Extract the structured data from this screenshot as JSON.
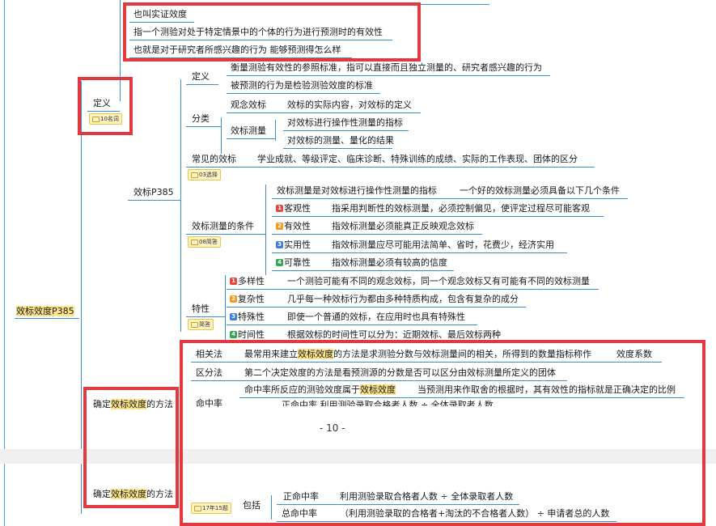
{
  "root": {
    "label": "效标效度P385"
  },
  "intro": [
    "也叫实证效度",
    "指一个测验对处于特定情景中的个体的行为进行预测时的有效性",
    "也就是对于研究者所感兴趣的行为 能够预测得怎么样"
  ],
  "definition": {
    "label": "定义",
    "badge": "10名词"
  },
  "criterion": {
    "label": "效标P385",
    "def_label": "定义",
    "def_items": [
      "衡量测验有效性的参照标准，指可以直接而且独立测量的、研究者感兴趣的行为",
      "被预测的行为是检验测验效度的标准"
    ],
    "class_label": "分类",
    "concept_label": "观念效标",
    "concept_text": "效标的实际内容，对效标的定义",
    "measure_label": "效标测量",
    "measure_items": [
      "对效标进行操作性测量的指标",
      "对效标的测量、量化的结果"
    ],
    "common_label": "常见的效标",
    "common_text": "学业成就、等级评定、临床诊断、特殊训练的成绩、实际的工作表现、团体的区分",
    "common_badge": "03选择",
    "cond_label": "效标测量的条件",
    "cond_badge": "08简答",
    "cond_head": "效标测量是对效标进行操作性测量的指标",
    "cond_head2": "一个好的效标测量必须具备以下几个条件",
    "conds": [
      {
        "num": "1",
        "label": "客观性",
        "text": "指采用判断性的效标测量，必须控制偏见，使评定过程尽可能客观"
      },
      {
        "num": "2",
        "label": "有效性",
        "text": "指效标测量必须能真正反映观念效标"
      },
      {
        "num": "3",
        "label": "实用性",
        "text": "指效标测量应尽可能用法简单、省时，花费少，经济实用"
      },
      {
        "num": "4",
        "label": "可靠性",
        "text": "指效标测量必须有较高的信度"
      }
    ],
    "feat_label": "特性",
    "feat_badge": "简答",
    "feats": [
      {
        "num": "1",
        "label": "多样性",
        "text": "一个测验可能有不同的观念效标，同一个观念效标又有可能有不同的效标测量"
      },
      {
        "num": "2",
        "label": "复杂性",
        "text": "几乎每一种效标行为都由多种特质构成，包含有复杂的成分"
      },
      {
        "num": "3",
        "label": "特殊性",
        "text": "即使一个普通的效标，在应用时也具有特殊性"
      },
      {
        "num": "4",
        "label": "时间性",
        "text": "根据效标的时间性可以分为：近期效标、最后效标两种"
      }
    ]
  },
  "method": {
    "label_pre": "确定",
    "label_hl": "效标效度",
    "label_post": "的方法",
    "corr_label": "相关法",
    "corr_pre": "最常用来建立",
    "corr_hl": "效标效度",
    "corr_post": "的方法是求测验分数与效标测量间的相关，所得到的数量指标称作",
    "corr_tail": "效度系数",
    "dist_label": "区分法",
    "dist_text": "第二个决定效度的方法是看预测源的分数是否可以区分由效标测量所定义的团体",
    "hit_label": "命中率",
    "hit_pre": "命中率所反应的测验效度属于",
    "hit_hl": "效标效度",
    "hit_post": "当预测用来作取舍的根据时，其有效性的指标就是正确决定的比例",
    "hit_cut": "正命中率      利用测验录取合格者人数 ÷ 全体录取者人数",
    "page_number": "- 10 -",
    "lower_label_pre": "确定",
    "lower_label_hl": "效标效度",
    "lower_label_post": "的方法",
    "lower_badge": "17年15题",
    "include_label": "包括",
    "pos_label": "正命中率",
    "pos_text": "利用测验录取合格者人数 ÷ 全体录取者人数",
    "total_label": "总命中率",
    "total_text": "（利用测验录取的合格者+淘汰的不合格者人数） ÷ 申请者总的人数"
  }
}
